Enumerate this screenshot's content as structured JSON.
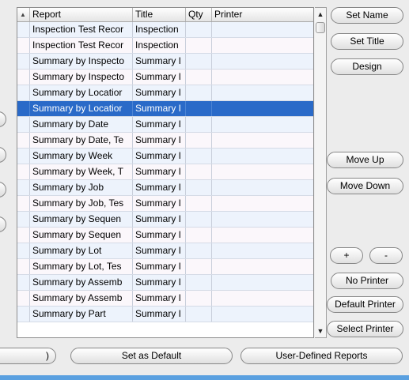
{
  "table": {
    "columns": [
      "Report",
      "Title",
      "Qty",
      "Printer"
    ],
    "sort_indicator": "▲",
    "rows": [
      {
        "report": "Inspection Test Recor",
        "title": "Inspection",
        "qty": "",
        "printer": ""
      },
      {
        "report": "Inspection Test Recor",
        "title": "Inspection",
        "qty": "",
        "printer": ""
      },
      {
        "report": "Summary by Inspecto",
        "title": "Summary I",
        "qty": "",
        "printer": ""
      },
      {
        "report": "Summary by Inspecto",
        "title": "Summary I",
        "qty": "",
        "printer": ""
      },
      {
        "report": "Summary by Locatior",
        "title": "Summary I",
        "qty": "",
        "printer": ""
      },
      {
        "report": "Summary by Locatior",
        "title": "Summary I",
        "qty": "",
        "printer": ""
      },
      {
        "report": "Summary by Date",
        "title": "Summary I",
        "qty": "",
        "printer": ""
      },
      {
        "report": "Summary by Date, Te",
        "title": "Summary I",
        "qty": "",
        "printer": ""
      },
      {
        "report": "Summary by Week",
        "title": "Summary I",
        "qty": "",
        "printer": ""
      },
      {
        "report": "Summary by Week, T",
        "title": "Summary I",
        "qty": "",
        "printer": ""
      },
      {
        "report": "Summary by Job",
        "title": "Summary I",
        "qty": "",
        "printer": ""
      },
      {
        "report": "Summary by Job, Tes",
        "title": "Summary I",
        "qty": "",
        "printer": ""
      },
      {
        "report": "Summary by Sequen",
        "title": "Summary I",
        "qty": "",
        "printer": ""
      },
      {
        "report": "Summary by Sequen",
        "title": "Summary I",
        "qty": "",
        "printer": ""
      },
      {
        "report": "Summary by Lot",
        "title": "Summary I",
        "qty": "",
        "printer": ""
      },
      {
        "report": "Summary by Lot, Tes",
        "title": "Summary I",
        "qty": "",
        "printer": ""
      },
      {
        "report": "Summary by Assemb",
        "title": "Summary I",
        "qty": "",
        "printer": ""
      },
      {
        "report": "Summary by Assemb",
        "title": "Summary I",
        "qty": "",
        "printer": ""
      },
      {
        "report": "Summary by Part",
        "title": "Summary I",
        "qty": "",
        "printer": ""
      }
    ],
    "selected_row": 5
  },
  "scrollbar": {
    "up_arrow": "▲",
    "down_arrow": "▼"
  },
  "side_buttons": {
    "set_name": "Set Name",
    "set_title": "Set Title",
    "design": "Design",
    "move_up": "Move Up",
    "move_down": "Move Down",
    "add": "+",
    "remove": "-",
    "no_printer": "No Printer",
    "default_printer": "Default Printer",
    "select_printer": "Select Printer"
  },
  "bottom_buttons": {
    "left_partial": ")",
    "set_as_default": "Set as Default",
    "user_defined_reports": "User-Defined Reports"
  },
  "colors": {
    "selection": "#2a6ac8",
    "row_even": "#edf3fc",
    "row_odd": "#fbf7fb",
    "bottom_bar": "#5aa0e0"
  }
}
